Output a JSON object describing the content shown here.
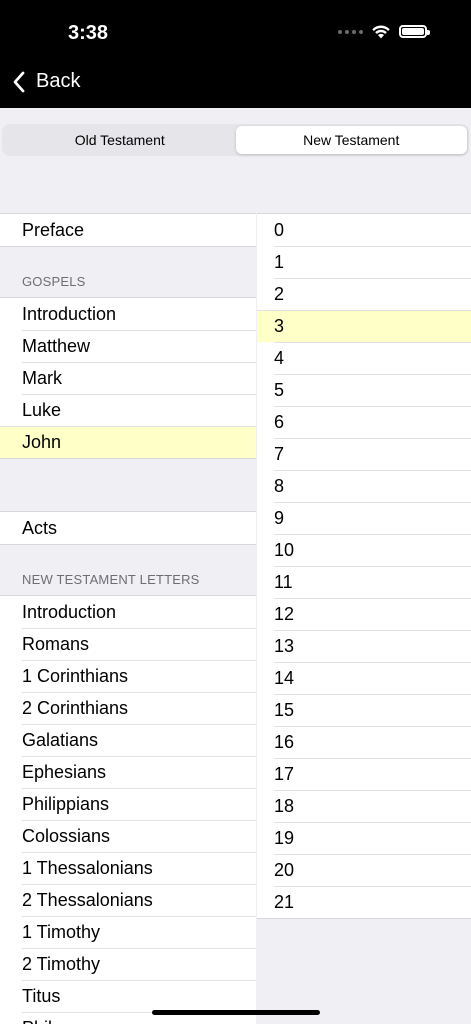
{
  "status_bar": {
    "time": "3:38"
  },
  "nav": {
    "back_label": "Back"
  },
  "tabs": [
    {
      "label": "Old Testament",
      "selected": false
    },
    {
      "label": "New Testament",
      "selected": true
    }
  ],
  "books": {
    "preface": {
      "label": "Preface"
    },
    "gospels": {
      "header": "GOSPELS",
      "items": [
        "Introduction",
        "Matthew",
        "Mark",
        "Luke",
        "John"
      ],
      "selected": "John"
    },
    "acts": {
      "label": "Acts"
    },
    "letters": {
      "header": "NEW TESTAMENT LETTERS",
      "items": [
        "Introduction",
        "Romans",
        "1 Corinthians",
        "2 Corinthians",
        "Galatians",
        "Ephesians",
        "Philippians",
        "Colossians",
        "1 Thessalonians",
        "2 Thessalonians",
        "1 Timothy",
        "2 Timothy",
        "Titus",
        "Philemon"
      ]
    }
  },
  "chapters": {
    "items": [
      "0",
      "1",
      "2",
      "3",
      "4",
      "5",
      "6",
      "7",
      "8",
      "9",
      "10",
      "11",
      "12",
      "13",
      "14",
      "15",
      "16",
      "17",
      "18",
      "19",
      "20",
      "21"
    ],
    "selected": "3"
  },
  "colors": {
    "selection": "#ffffc8",
    "background": "#efeff4",
    "topbar": "#000000"
  }
}
